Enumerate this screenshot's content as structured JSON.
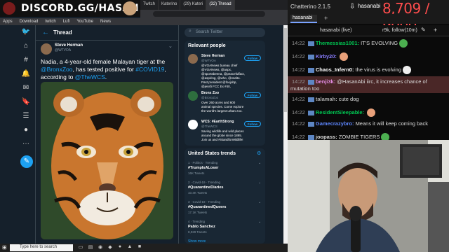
{
  "banner": {
    "text": "DISCORD.GG/HASAN"
  },
  "browser": {
    "tabs": [
      {
        "label": "Twitch"
      },
      {
        "label": "Katerino"
      },
      {
        "label": "(29) Kateri"
      },
      {
        "label": "(32) Thread",
        "active": true
      }
    ],
    "bookmarks": [
      "Apps",
      "Download",
      "twitch",
      "Lufi",
      "YouTube",
      "News"
    ]
  },
  "twitter": {
    "thread_title": "Thread",
    "author_name": "Steve Herman",
    "author_handle": "@W7VOA",
    "tweet_text_1": "Nadia, a 4-year-old female Malayan tiger at the",
    "tweet_link_1": "@BronxZoo",
    "tweet_text_2": ", has tested positive for",
    "tweet_link_2": "#COVID19",
    "tweet_text_3": ",",
    "tweet_text_4": "according to",
    "tweet_link_3": "@TheWCS",
    "tweet_text_5": ".",
    "search_placeholder": "Search Twitter",
    "relevant_title": "Relevant people",
    "follow_label": "Follow",
    "people": [
      {
        "name": "Steve Herman",
        "handle": "@W7VOA",
        "bio": "@VOANews bureau chief @VOANews, @aspx, @sportsbeena, @peacefulfact, @aspiring, @who, @vsalto. Past president @foojobp, @jessfi FCC Ex #40, @Discovery.",
        "color": "#8b6a4e"
      },
      {
        "name": "Bronx Zoo",
        "handle": "@BronxZoo",
        "bio": "Over 260 acres and 600 animal species. Come explore the world's largest urban zoo.",
        "color": "#2e6e3e"
      },
      {
        "name": "WCS: #EarthStrong",
        "handle": "@TheWCS",
        "bio": "Saving wildlife and wild places around the globe since 1895. Join us and #StandforWildlife!",
        "color": "#ffffff"
      }
    ],
    "trends_title": "United States trends",
    "trends": [
      {
        "meta": "1 · Politics · Trending",
        "name": "#TrumpIsALoser",
        "count": "16K Tweets"
      },
      {
        "meta": "2 · Covid-19 · Trending",
        "name": "#QuarantineDiaries",
        "count": "10.4K Tweets"
      },
      {
        "meta": "3 · Covid-19 · Trending",
        "name": "#QuarantinedQueers",
        "count": "17.1K Tweets"
      },
      {
        "meta": "4 · Trending",
        "name": "Pablo Sanchez",
        "count": "8,029 Tweets"
      }
    ],
    "show_more": "Show more"
  },
  "taskbar": {
    "search_placeholder": "Type here to search"
  },
  "chat": {
    "app_title": "Chatterino 2.1.5",
    "channel_top": "hasanabi",
    "counter": "8,709 / 9000",
    "tab_label": "hasanabi",
    "header_title": "hasanabi (live)",
    "header_mode": "r9k, follow(10m)",
    "messages": [
      {
        "ts": "14:22",
        "user": "Themessias1001",
        "color": "#00c853",
        "text": "IT'S EVOLVING",
        "emote": "#4caf50"
      },
      {
        "ts": "14:22",
        "user": "Kirby20",
        "color": "#8a7dff",
        "text": "",
        "emote": "#e8a07a"
      },
      {
        "ts": "14:22",
        "user": "Chaos_Infern0",
        "color": "#ffffff",
        "text": "the virus is evolving",
        "emote": "#eeeeee"
      },
      {
        "ts": "14:22",
        "user": "benji3k",
        "color": "#e08ae0",
        "text": "@HasanAbi iirc, it increases chance of",
        "emote": ""
      },
      {
        "ts": "",
        "user": "",
        "color": "#dddddd",
        "text": "mutation too",
        "emote": ""
      },
      {
        "ts": "14:22",
        "user": "talamah",
        "color": "#aaaaaa",
        "text": "cute dog",
        "emote": ""
      },
      {
        "ts": "14:22",
        "user": "ResidentSleepable",
        "color": "#00c853",
        "text": "",
        "emote": "#e8a07a"
      },
      {
        "ts": "14:22",
        "user": "Gamecrazybro",
        "color": "#5e87ff",
        "text": "Means it will keep coming back",
        "emote": ""
      },
      {
        "ts": "14:22",
        "user": "joopass",
        "color": "#dddddd",
        "text": "ZOMBIE TIGERS",
        "emote": "#4caf50"
      }
    ]
  }
}
